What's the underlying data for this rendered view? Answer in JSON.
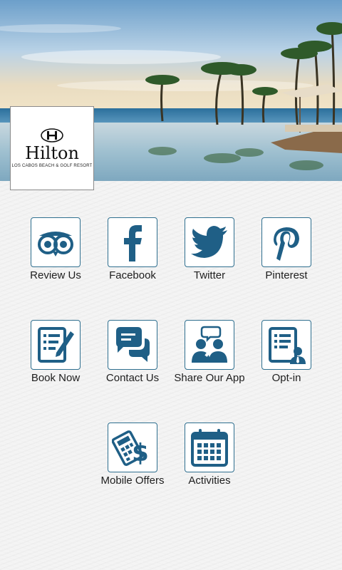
{
  "header": {
    "brand_name": "Hilton",
    "brand_subtitle": "LOS CABOS BEACH & GOLF RESORT"
  },
  "colors": {
    "icon_blue": "#1f5f86",
    "icon_border": "#2f6f8f"
  },
  "tiles": [
    {
      "label": "Review Us",
      "icon": "tripadvisor-owl-icon"
    },
    {
      "label": "Facebook",
      "icon": "facebook-icon"
    },
    {
      "label": "Twitter",
      "icon": "twitter-bird-icon"
    },
    {
      "label": "Pinterest",
      "icon": "pinterest-icon"
    },
    {
      "label": "Book Now",
      "icon": "document-pen-icon"
    },
    {
      "label": "Contact Us",
      "icon": "chat-bubbles-icon"
    },
    {
      "label": "Share Our App",
      "icon": "people-share-icon"
    },
    {
      "label": "Opt-in",
      "icon": "document-user-icon"
    },
    {
      "label": "Mobile Offers",
      "icon": "calculator-dollar-icon"
    },
    {
      "label": "Activities",
      "icon": "calendar-icon"
    }
  ]
}
